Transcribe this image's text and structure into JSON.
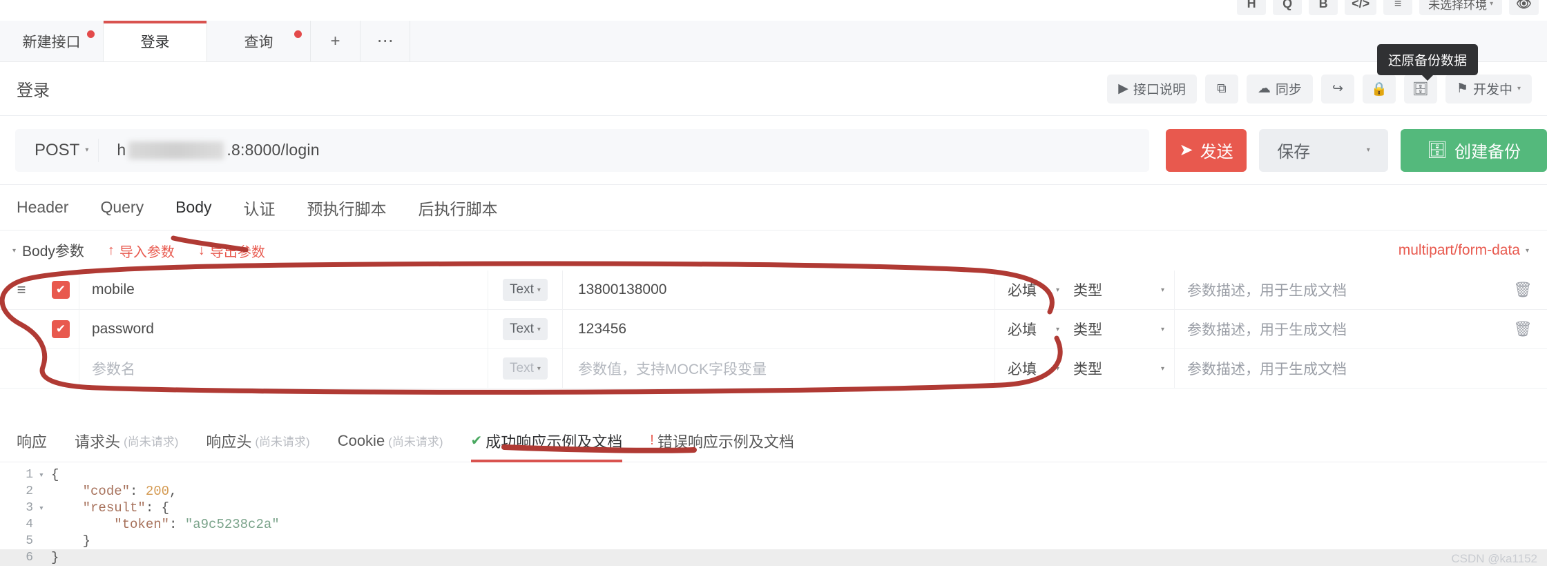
{
  "top_icons": [
    {
      "label": "H",
      "name": "header-shortcut-button"
    },
    {
      "label": "Q",
      "name": "query-shortcut-button"
    },
    {
      "label": "B",
      "name": "body-shortcut-button"
    },
    {
      "label": "</>",
      "name": "code-shortcut-button"
    },
    {
      "label": "≡",
      "name": "settings-shortcut-button"
    }
  ],
  "environment": {
    "label": "未选择环境",
    "caret": "▾"
  },
  "eye_icon": "👁",
  "tabs": [
    {
      "label": "新建接口",
      "dot": true,
      "active": false,
      "name": "tab-new-api"
    },
    {
      "label": "登录",
      "dot": false,
      "active": true,
      "name": "tab-login"
    },
    {
      "label": "查询",
      "dot": true,
      "active": false,
      "name": "tab-query"
    },
    {
      "label": "+",
      "icon": true,
      "name": "tab-add"
    },
    {
      "label": "⋯",
      "icon": true,
      "name": "tab-more"
    }
  ],
  "api": {
    "title": "登录",
    "tooltip": "还原备份数据",
    "tools": [
      {
        "label": "接口说明",
        "icon": "▶",
        "name": "api-description-button"
      },
      {
        "label": "",
        "icon": "⧉",
        "name": "copy-button"
      },
      {
        "label": "同步",
        "icon": "☁",
        "name": "sync-button"
      },
      {
        "label": "",
        "icon": "↪",
        "name": "share-button"
      },
      {
        "label": "",
        "icon": "🔒",
        "name": "lock-button"
      },
      {
        "label": "",
        "icon": "🗄",
        "name": "restore-backup-button"
      }
    ],
    "status": {
      "label": "开发中",
      "icon": "⚑",
      "caret": "▾"
    }
  },
  "request": {
    "method": "POST",
    "method_caret": "▾",
    "url_prefix": "h",
    "url_suffix": ".8:8000/login",
    "send_label": "发送",
    "send_icon": "➤",
    "save_label": "保存",
    "save_caret": "▾",
    "backup_label": "创建备份",
    "backup_icon": "🗄"
  },
  "request_tabs": [
    {
      "label": "Header",
      "active": false,
      "name": "tab-header"
    },
    {
      "label": "Query",
      "active": false,
      "name": "tab-query-params"
    },
    {
      "label": "Body",
      "active": true,
      "name": "tab-body"
    },
    {
      "label": "认证",
      "active": false,
      "name": "tab-auth"
    },
    {
      "label": "预执行脚本",
      "active": false,
      "name": "tab-pre-script"
    },
    {
      "label": "后执行脚本",
      "active": false,
      "name": "tab-post-script"
    }
  ],
  "body_header": {
    "title": "Body参数",
    "collapse_caret": "▾",
    "import_label": "导入参数",
    "import_icon": "↑",
    "export_label": "导出参数",
    "export_icon": "↓",
    "content_type": "multipart/form-data",
    "content_type_caret": "▾"
  },
  "param_table": {
    "type_caret": "▾",
    "required_caret": "▾",
    "kind_caret": "▾",
    "delete_icon": "🗑",
    "handle_icon": "≡",
    "check_icon": "✔",
    "rows": [
      {
        "checked": true,
        "name": "mobile",
        "type": "Text",
        "value": "13800138000",
        "required": "必填",
        "kind": "类型",
        "desc": "参数描述，用于生成文档",
        "placeholder_row": false,
        "show_handle": true,
        "show_delete": true
      },
      {
        "checked": true,
        "name": "password",
        "type": "Text",
        "value": "123456",
        "required": "必填",
        "kind": "类型",
        "desc": "参数描述，用于生成文档",
        "placeholder_row": false,
        "show_handle": false,
        "show_delete": true
      },
      {
        "checked": false,
        "name": "参数名",
        "type": "Text",
        "value": "参数值，支持MOCK字段变量",
        "required": "必填",
        "kind": "类型",
        "desc": "参数描述，用于生成文档",
        "placeholder_row": true,
        "show_handle": false,
        "show_delete": false
      }
    ]
  },
  "response_tabs": [
    {
      "label": "响应",
      "sub": "",
      "active": false,
      "icon": "",
      "name": "tab-response"
    },
    {
      "label": "请求头",
      "sub": "(尚未请求)",
      "active": false,
      "icon": "",
      "name": "tab-request-headers"
    },
    {
      "label": "响应头",
      "sub": "(尚未请求)",
      "active": false,
      "icon": "",
      "name": "tab-response-headers"
    },
    {
      "label": "Cookie",
      "sub": "(尚未请求)",
      "active": false,
      "icon": "",
      "name": "tab-cookie"
    },
    {
      "label": "成功响应示例及文档",
      "sub": "",
      "active": true,
      "icon": "✔",
      "name": "tab-success-example"
    },
    {
      "label": "错误响应示例及文档",
      "sub": "",
      "active": false,
      "icon": "!",
      "name": "tab-error-example"
    }
  ],
  "code": {
    "lines": [
      {
        "no": "1",
        "fold": "▾",
        "text": "{",
        "hl": false
      },
      {
        "no": "2",
        "fold": "",
        "text": "    \"code\": 200,",
        "hl": false
      },
      {
        "no": "3",
        "fold": "▾",
        "text": "    \"result\": {",
        "hl": false
      },
      {
        "no": "4",
        "fold": "",
        "text": "        \"token\": \"a9c5238c2a\"",
        "hl": false
      },
      {
        "no": "5",
        "fold": "",
        "text": "    }",
        "hl": false
      },
      {
        "no": "6",
        "fold": "",
        "text": "}",
        "hl": true
      }
    ]
  },
  "watermark": "CSDN @ka1152",
  "colors": {
    "accent_red": "#e8594e",
    "tab_underline": "#d9534f",
    "green": "#54b97c",
    "success": "#49a860",
    "annotation": "#b03a34"
  }
}
